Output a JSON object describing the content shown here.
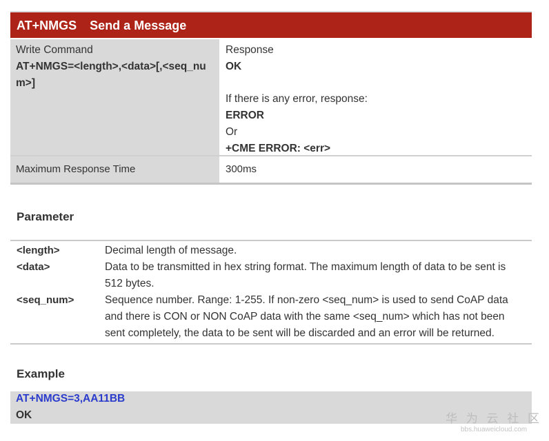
{
  "header": {
    "command_name": "AT+NMGS",
    "title": "Send a Message"
  },
  "command_table": {
    "write_command_label": "Write Command",
    "write_command_syntax_line1": "AT+NMGS=<length>,<data>[,<seq_nu",
    "write_command_syntax_line2": "m>]",
    "response_label": "Response",
    "response_ok": "OK",
    "error_intro": "If there is any error, response:",
    "error": "ERROR",
    "or": "Or",
    "cme_error": "+CME ERROR: <err>",
    "max_response_time_label": "Maximum Response Time",
    "max_response_time_value": "300ms"
  },
  "parameter_section": {
    "heading": "Parameter",
    "params": [
      {
        "name": "<length>",
        "desc_lines": [
          "Decimal length of message."
        ]
      },
      {
        "name": "<data>",
        "desc_lines": [
          "Data to be transmitted in hex string format. The maximum length of data to be sent is",
          "512 bytes."
        ]
      },
      {
        "name": "<seq_num>",
        "desc_lines": [
          "Sequence number. Range: 1-255. If non-zero <seq_num> is used to send CoAP data",
          "and there is CON or NON CoAP data with the same <seq_num> which has not been",
          "sent completely, the data to be sent will be discarded and an error will be returned."
        ]
      }
    ]
  },
  "example_section": {
    "heading": "Example",
    "command": "AT+NMGS=3,AA11BB",
    "response": "OK"
  },
  "watermark": {
    "text": "华 为 云 社 区",
    "url": "bbs.huaweicloud.com"
  }
}
